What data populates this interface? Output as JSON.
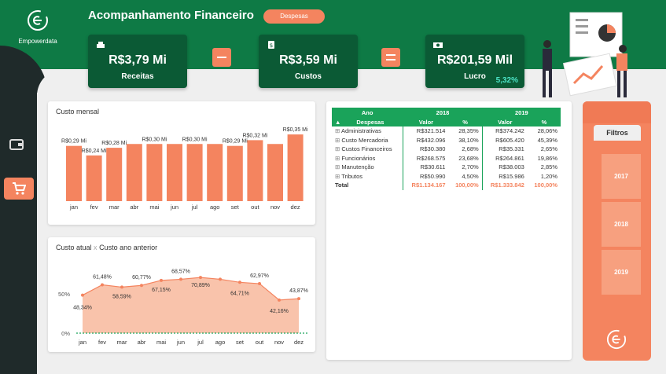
{
  "brand": {
    "name": "Empowerdata"
  },
  "header": {
    "title": "Acompanhamento Financeiro",
    "pill": "Despesas"
  },
  "kpis": {
    "receitas": {
      "value": "R$3,79 Mi",
      "label": "Receitas"
    },
    "custos": {
      "value": "R$3,59 Mi",
      "label": "Custos"
    },
    "lucro": {
      "value": "R$201,59 Mil",
      "label": "Lucro",
      "pct": "5,32%"
    }
  },
  "colors": {
    "brand_green": "#0e7a45",
    "kpi_green": "#0b5a35",
    "accent_orange": "#f4845f",
    "bar_orange": "#f4845f",
    "line_dots": "#1aa35a"
  },
  "icons": {
    "wallet": "wallet-icon",
    "cart": "shopping-cart-icon",
    "register": "cash-register-icon",
    "money": "money-bag-icon",
    "bill": "banknote-icon"
  },
  "panels": {
    "monthly_title": "Custo mensal",
    "compare_title": "Custo atual",
    "compare_x": "x",
    "compare_title2": "Custo ano anterior"
  },
  "chart_data": [
    {
      "type": "bar",
      "title": "Custo mensal",
      "categories": [
        "jan",
        "fev",
        "mar",
        "abr",
        "mai",
        "jun",
        "jul",
        "ago",
        "set",
        "out",
        "nov",
        "dez"
      ],
      "values": [
        0.29,
        0.24,
        0.28,
        0.3,
        0.3,
        0.3,
        0.3,
        0.3,
        0.29,
        0.32,
        0.3,
        0.35
      ],
      "labels": [
        "R$0,29 Mi",
        "R$0,24 Mi",
        "R$0,28 Mi",
        "",
        "R$0,30 Mi",
        "",
        "R$0,30 Mi",
        "",
        "R$0,29 Mi",
        "R$0,32 Mi",
        "",
        "R$0,35 Mi"
      ],
      "ylim": [
        0,
        0.4
      ]
    },
    {
      "type": "area",
      "title": "Custo atual x Custo ano anterior",
      "categories": [
        "jan",
        "fev",
        "mar",
        "abr",
        "mai",
        "jun",
        "jul",
        "ago",
        "set",
        "out",
        "nov",
        "dez"
      ],
      "values": [
        48.34,
        61.48,
        58.59,
        60.77,
        67.15,
        68.57,
        70.89,
        68.57,
        64.71,
        62.97,
        42.16,
        43.87
      ],
      "labels": [
        "48,34%",
        "61,48%",
        "58,59%",
        "60,77%",
        "67,15%",
        "68,57%",
        "70,89%",
        "",
        "64,71%",
        "62,97%",
        "42,16%",
        "43,87%"
      ],
      "yticks": [
        "50%",
        "0%"
      ],
      "ylim": [
        0,
        100
      ]
    }
  ],
  "table": {
    "col_ano": "Ano",
    "col_despesas": "Despesas",
    "years": [
      "2018",
      "2019"
    ],
    "sub_valor": "Valor",
    "sub_pct": "%",
    "rows": [
      {
        "name": "Administrativas",
        "v1": "R$321.514",
        "p1": "28,35%",
        "v2": "R$374.242",
        "p2": "28,06%"
      },
      {
        "name": "Custo Mercadoria",
        "v1": "R$432.096",
        "p1": "38,10%",
        "v2": "R$605.420",
        "p2": "45,39%"
      },
      {
        "name": "Custos Financeiros",
        "v1": "R$30.380",
        "p1": "2,68%",
        "v2": "R$35.331",
        "p2": "2,65%"
      },
      {
        "name": "Funcionários",
        "v1": "R$268.575",
        "p1": "23,68%",
        "v2": "R$264.861",
        "p2": "19,86%"
      },
      {
        "name": "Manutenção",
        "v1": "R$30.611",
        "p1": "2,70%",
        "v2": "R$38.003",
        "p2": "2,85%"
      },
      {
        "name": "Tributos",
        "v1": "R$50.990",
        "p1": "4,50%",
        "v2": "R$15.986",
        "p2": "1,20%"
      }
    ],
    "total": {
      "name": "Total",
      "v1": "R$1.134.167",
      "p1": "100,00%",
      "v2": "R$1.333.842",
      "p2": "100,00%"
    }
  },
  "filters": {
    "title": "Filtros",
    "years": [
      "2017",
      "2018",
      "2019"
    ]
  }
}
